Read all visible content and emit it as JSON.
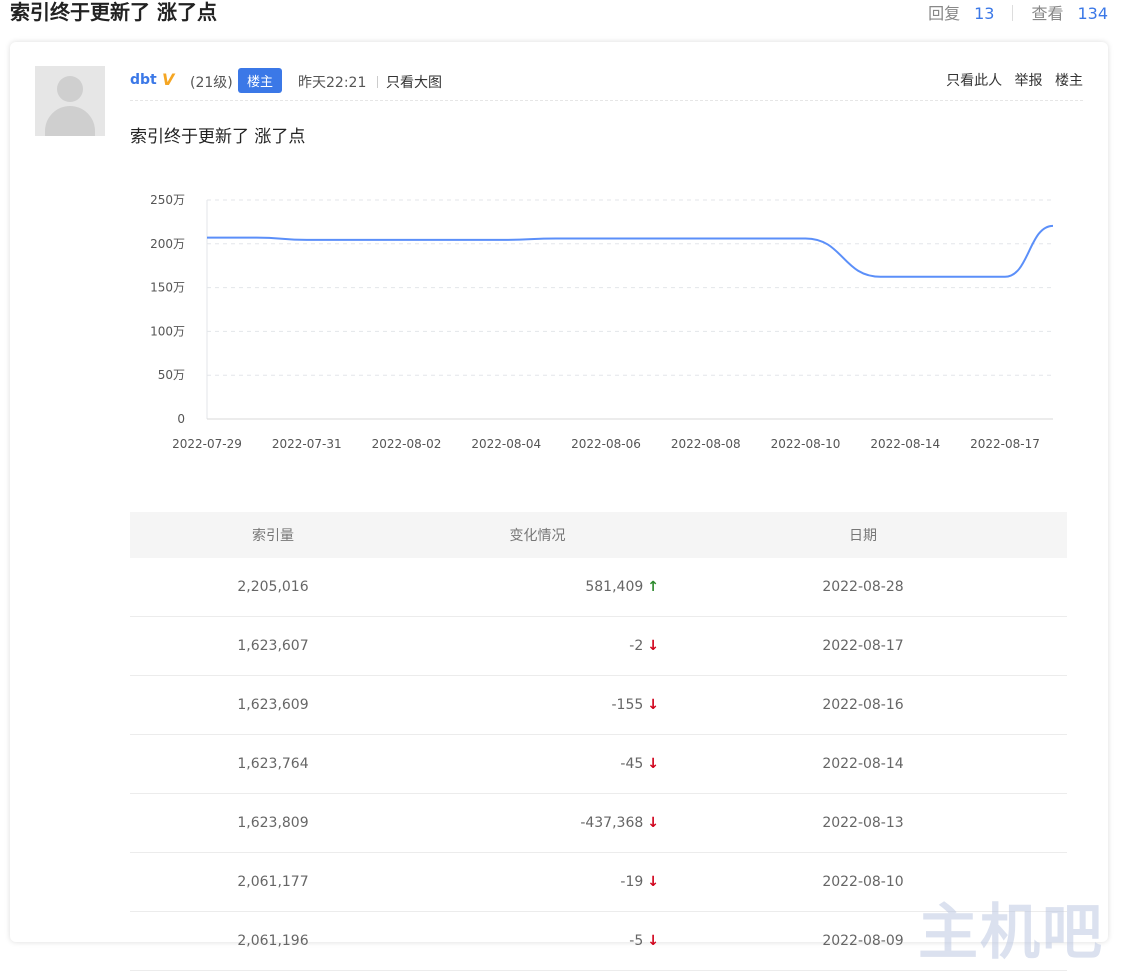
{
  "thread": {
    "title": "索引终于更新了 涨了点",
    "replies_label": "回复",
    "replies": "13",
    "views_label": "查看",
    "views": "134"
  },
  "post": {
    "username": "dbt",
    "vip_icon": "V",
    "level": "(21级)",
    "op_badge": "楼主",
    "time": "昨天22:21",
    "view_big": "只看大图",
    "actions": [
      "只看此人",
      "举报",
      "楼主"
    ],
    "content": "索引终于更新了 涨了点"
  },
  "chart_data": {
    "type": "line",
    "categories": [
      "2022-07-29",
      "2022-07-31",
      "2022-08-02",
      "2022-08-04",
      "2022-08-06",
      "2022-08-08",
      "2022-08-10",
      "2022-08-14",
      "2022-08-17"
    ],
    "y_ticks": [
      "0",
      "50万",
      "100万",
      "150万",
      "200万",
      "250万"
    ],
    "ylim": [
      0,
      2500000
    ],
    "series": [
      {
        "color": "#5b8ff9",
        "x": [
          "2022-07-29",
          "2022-07-30",
          "2022-07-31",
          "2022-08-01",
          "2022-08-02",
          "2022-08-03",
          "2022-08-04",
          "2022-08-05",
          "2022-08-06",
          "2022-08-07",
          "2022-08-08",
          "2022-08-09",
          "2022-08-10",
          "2022-08-13",
          "2022-08-14",
          "2022-08-16",
          "2022-08-17",
          "2022-08-28"
        ],
        "values": [
          2070000,
          2070000,
          2045000,
          2045000,
          2045000,
          2045000,
          2045000,
          2061000,
          2061000,
          2061000,
          2061000,
          2061000,
          2061000,
          1623809,
          1623764,
          1623609,
          1623607,
          2205016
        ]
      }
    ],
    "grid": true
  },
  "table": {
    "headers": [
      "索引量",
      "变化情况",
      "日期"
    ],
    "rows": [
      {
        "index": "2,205,016",
        "change": "581,409",
        "dir": "up",
        "date": "2022-08-28"
      },
      {
        "index": "1,623,607",
        "change": "-2",
        "dir": "down",
        "date": "2022-08-17"
      },
      {
        "index": "1,623,609",
        "change": "-155",
        "dir": "down",
        "date": "2022-08-16"
      },
      {
        "index": "1,623,764",
        "change": "-45",
        "dir": "down",
        "date": "2022-08-14"
      },
      {
        "index": "1,623,809",
        "change": "-437,368",
        "dir": "down",
        "date": "2022-08-13"
      },
      {
        "index": "2,061,177",
        "change": "-19",
        "dir": "down",
        "date": "2022-08-10"
      },
      {
        "index": "2,061,196",
        "change": "-5",
        "dir": "down",
        "date": "2022-08-09"
      }
    ]
  },
  "arrows": {
    "up": "↑",
    "down": "↓"
  },
  "watermark": "主机吧"
}
